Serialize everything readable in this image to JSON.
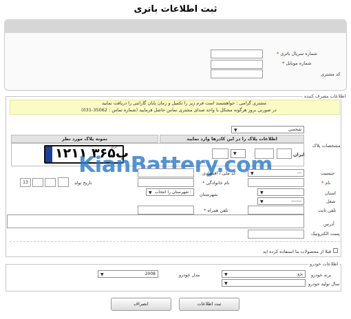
{
  "page_title": "ثبت اطلاعات باتری",
  "battery": {
    "serial_label": "شماره سریال باتری",
    "mobile_label": "شماره موبایل",
    "customer_code_label": "کد مشتری"
  },
  "consumer": {
    "legend": "اطلاعات مصرف کننده",
    "notice_line1": "مشتری گرامی : خواهشمند است فرم زیر را تکمیل و زمان پایان گارانتی را دریافت نمایید",
    "notice_line2": "در صورتی بروز هرگونه مشکل با واحد صدای مشتری تماس حاصل فرمایید (شماره تماس : 35062-031)",
    "plate_type_value": "شخصی",
    "plate_spec_label": "مشخصات پلاک",
    "plate_input_header": "اطلاعات پلاک را در این کادرها وارد نمایید",
    "plate_sample_header": "نمونه پلاک مورد نظر",
    "plate_country": "ایران",
    "plate_sample_text": "۱۲ب۳۶۵ ۱۱",
    "plate_sample_region": "ایران",
    "gender_label": "جنسیت",
    "national_code_label": "کد ملی / اقتصادی",
    "name_label": "نام",
    "family_label": "نام خانوادگی",
    "birth_label": "تاریخ تولد",
    "birth_day_value": "13",
    "province_label": "استان",
    "city_label": "شهرستان",
    "city_value": "شهرستان را انتخاب :",
    "job_label": "شغل",
    "job_value": "-------",
    "gender_value": "---",
    "phone_label": "تلفن ثابت",
    "cell_label": "تلفن همراه",
    "address_label": "آدرس",
    "email_label": "پست الکترونیک",
    "used_before_label": "قبلا از محصولات ما استفاده کرده اید"
  },
  "vehicle": {
    "legend": "اطلاعات خودرو",
    "brand_label": "برند خودرو",
    "brand_value": "پژو",
    "model_label": "مدل خودرو",
    "year_label": "سال تولید خودرو",
    "year_value": "2008"
  },
  "actions": {
    "submit_label": "ثبت اطلاعات",
    "cancel_label": "انصراف"
  },
  "watermark": "KianBattery.com"
}
